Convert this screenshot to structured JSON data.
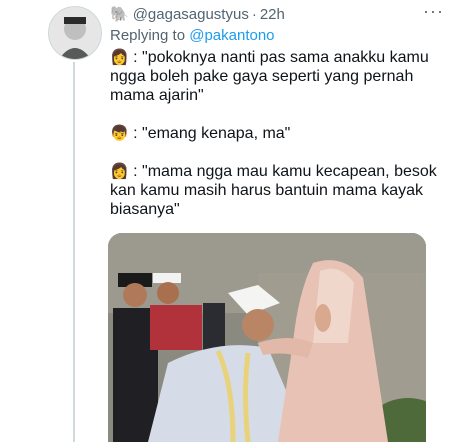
{
  "tweet": {
    "display_icon": "elephant-icon",
    "handle": "@gagasagustyus",
    "separator": "·",
    "time": "22h",
    "more": "···",
    "replying_prefix": "Replying to ",
    "replying_to": "@pakantono",
    "lines": [
      {
        "emoji": "👩",
        "text": " : \"pokoknya nanti pas sama anakku kamu ngga boleh pake gaya seperti yang pernah mama ajarin\""
      },
      {
        "emoji": "👦",
        "text": " : \"emang kenapa, ma\""
      },
      {
        "emoji": "👩",
        "text": " : \"mama ngga mau kamu kecapean, besok kan kamu masih harus bantuin mama kayak biasanya\""
      }
    ]
  },
  "colors": {
    "text": "#0f1419",
    "secondary": "#536471",
    "link": "#1d9bf0"
  }
}
